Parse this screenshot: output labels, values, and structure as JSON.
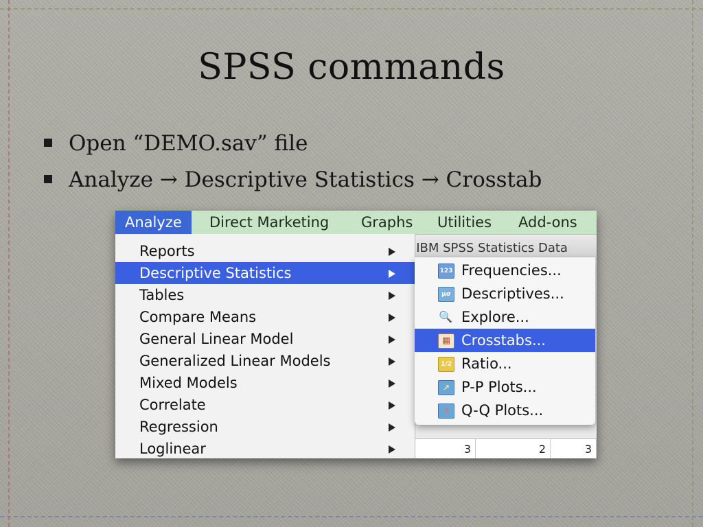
{
  "slide": {
    "title": "SPSS commands",
    "bullets": [
      "Open “DEMO.sav” file",
      "Analyze → Descriptive Statistics → Crosstab"
    ]
  },
  "screenshot": {
    "menubar": [
      "Analyze",
      "Direct Marketing",
      "Graphs",
      "Utilities",
      "Add-ons"
    ],
    "active_menu": "Analyze",
    "background_window_title": "- IBM SPSS Statistics Data",
    "analyze_menu": {
      "items": [
        "Reports",
        "Descriptive Statistics",
        "Tables",
        "Compare Means",
        "General Linear Model",
        "Generalized Linear Models",
        "Mixed Models",
        "Correlate",
        "Regression",
        "Loglinear"
      ],
      "highlighted": "Descriptive Statistics"
    },
    "descriptive_submenu": {
      "items": [
        {
          "label": "Frequencies...",
          "icon": "frequencies-icon",
          "glyph": "123"
        },
        {
          "label": "Descriptives...",
          "icon": "descriptives-icon",
          "glyph": "μσ"
        },
        {
          "label": "Explore...",
          "icon": "explore-icon",
          "glyph": "🔍"
        },
        {
          "label": "Crosstabs...",
          "icon": "crosstabs-icon",
          "glyph": "▦"
        },
        {
          "label": "Ratio...",
          "icon": "ratio-icon",
          "glyph": "1/2"
        },
        {
          "label": "P-P Plots...",
          "icon": "pp-plots-icon",
          "glyph": "↗"
        },
        {
          "label": "Q-Q Plots...",
          "icon": "qq-plots-icon",
          "glyph": "↗"
        }
      ],
      "highlighted": "Crosstabs..."
    },
    "grid_values": [
      "3",
      "2",
      "3"
    ],
    "colors": {
      "menubar": "#c8e6c7",
      "highlight": "#3a5fe0"
    }
  }
}
